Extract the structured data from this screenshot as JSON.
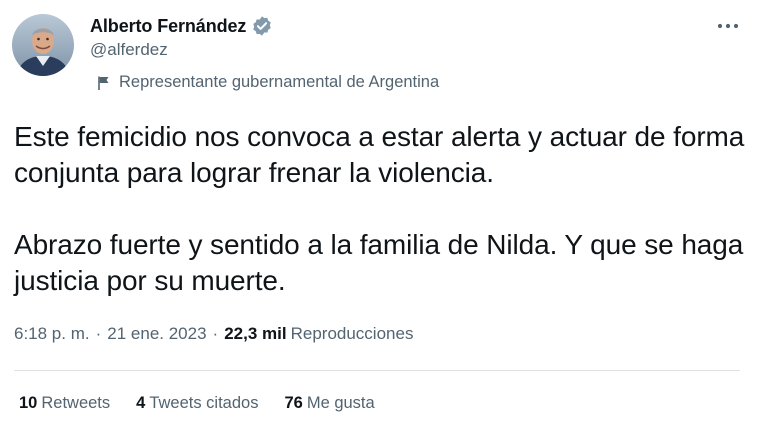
{
  "author": {
    "name": "Alberto Fernández",
    "handle": "@alferdez",
    "label": "Representante gubernamental de Argentina"
  },
  "tweet": {
    "paragraphs": [
      "Este femicidio nos convoca a estar alerta y actuar de forma conjunta para lograr frenar la violencia.",
      "Abrazo fuerte y sentido a la familia de Nilda. Y que se haga justicia por su muerte."
    ],
    "time": "6:18 p. m.",
    "date": "21 ene. 2023",
    "separator": "·",
    "views_count": "22,3 mil",
    "views_label": "Reproducciones"
  },
  "stats": {
    "retweets_count": "10",
    "retweets_label": "Retweets",
    "quotes_count": "4",
    "quotes_label": "Tweets citados",
    "likes_count": "76",
    "likes_label": "Me gusta"
  },
  "icons": {
    "verified": "verified-badge-icon",
    "label_flag": "flag-icon",
    "more": "more-options-icon"
  },
  "colors": {
    "text_primary": "#0f1419",
    "text_secondary": "#536471",
    "verified_badge": "#829aab",
    "divider": "#dfe3e6"
  }
}
